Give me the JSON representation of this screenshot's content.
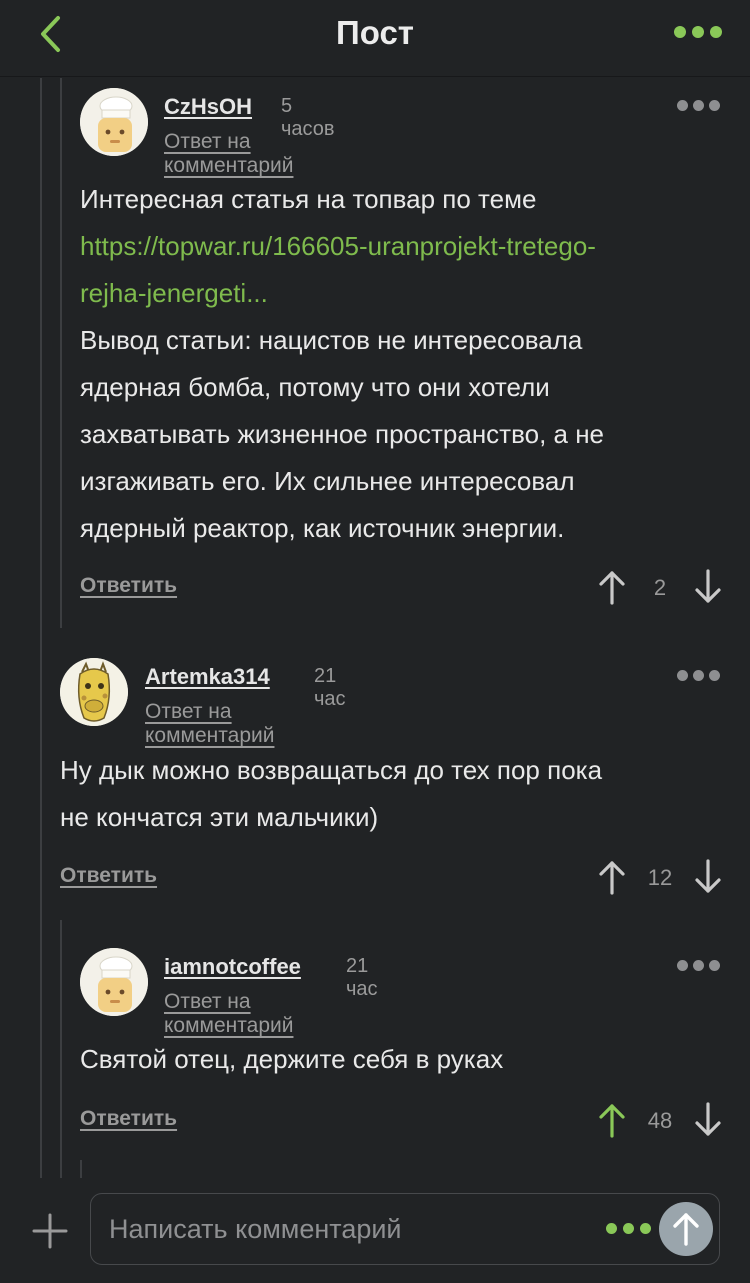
{
  "header": {
    "title": "Пост"
  },
  "comments": [
    {
      "username": "CzHsOH",
      "time": "5 часов",
      "reply_to": "Ответ на комментарий",
      "text_intro": "Интересная статья на топвар по теме",
      "link_line1": "https://topwar.ru/166605-uranprojekt-tretego-",
      "link_line2": "rejha-jenergeti...",
      "body_lines": [
        "Вывод статьи: нацистов не интересовала",
        "ядерная бомба, потому что они хотели",
        "захватывать жизненное пространство, а не",
        "изгаживать его. Их сильнее интересовал",
        "ядерный реактор, как источник энергии."
      ],
      "answer": "Ответить",
      "rating": "2"
    },
    {
      "username": "Artemka314",
      "time": "21 час",
      "reply_to": "Ответ на комментарий",
      "body_lines": [
        "Ну дык можно возвращаться до тех пор пока",
        "не кончатся эти мальчики)"
      ],
      "answer": "Ответить",
      "rating": "12"
    },
    {
      "username": "iamnotcoffee",
      "time": "21 час",
      "reply_to": "Ответ на комментарий",
      "body_lines": [
        "Святой отец, держите себя в руках"
      ],
      "answer": "Ответить",
      "rating": "48"
    }
  ],
  "composer": {
    "placeholder": "Написать комментарий"
  },
  "colors": {
    "accent": "#8ac858",
    "link": "#7fbb4d",
    "background": "#212325"
  }
}
